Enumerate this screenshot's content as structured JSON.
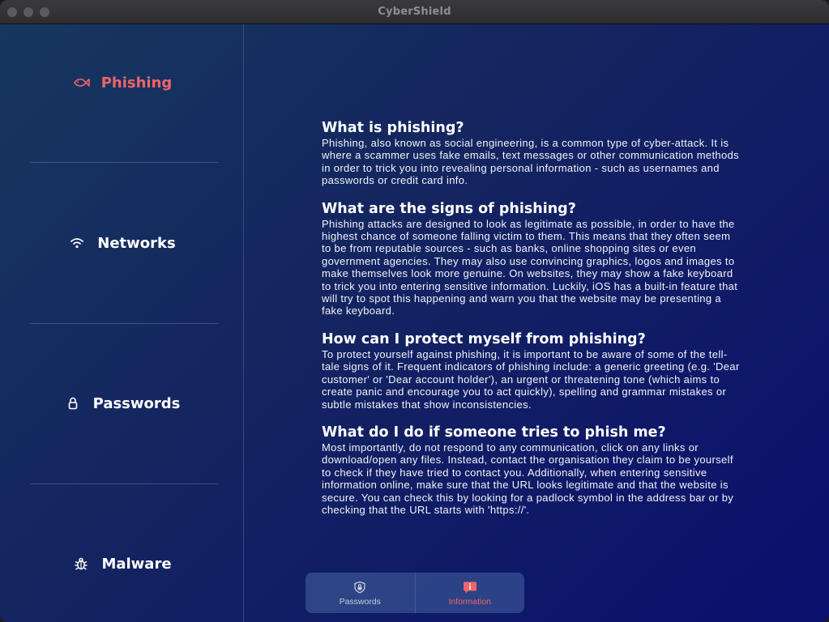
{
  "window": {
    "title": "CyberShield"
  },
  "sidebar": {
    "items": [
      {
        "label": "Phishing",
        "icon": "fish-icon",
        "active": true
      },
      {
        "label": "Networks",
        "icon": "wifi-icon",
        "active": false
      },
      {
        "label": "Passwords",
        "icon": "lock-icon",
        "active": false
      },
      {
        "label": "Malware",
        "icon": "bug-icon",
        "active": false
      }
    ]
  },
  "content": {
    "sections": [
      {
        "heading": "What is phishing?",
        "body": "Phishing, also known as social engineering, is a common type of cyber-attack. It is where a scammer uses fake emails, text messages or other communication methods in order to trick you into revealing personal information - such as usernames and passwords or credit card info."
      },
      {
        "heading": "What are the signs of phishing?",
        "body": "Phishing attacks are designed to look as legitimate as possible, in order to have the highest chance of someone falling victim to them. This means that they often seem to be from reputable sources - such as banks, online shopping sites or even government agencies. They may also use convincing graphics, logos and images to make themselves look more genuine. On websites, they may show a fake keyboard to trick you into entering sensitive information. Luckily, iOS has a built-in feature that will try to spot this happening and warn you that the website may be presenting a fake keyboard."
      },
      {
        "heading": "How can I protect myself from phishing?",
        "body": "To protect yourself against phishing, it is important to be aware of some of the tell-tale signs of it. Frequent indicators of phishing include: a generic greeting (e.g. 'Dear customer' or 'Dear account holder'), an urgent or threatening tone (which aims to create panic and encourage you to act quickly), spelling and grammar mistakes or subtle mistakes that show inconsistencies."
      },
      {
        "heading": "What do I do if someone tries to phish me?",
        "body": "Most importantly, do not respond to any communication, click on any links or download/open any files. Instead, contact the organisation they claim to be yourself to check if they have tried to contact you. Additionally, when entering sensitive information online, make sure that the URL looks legitimate and that the website is secure. You can check this by looking for a padlock symbol in the address bar or by checking that the URL starts with 'https://'."
      }
    ]
  },
  "tabbar": {
    "tabs": [
      {
        "label": "Passwords",
        "icon": "shield-lock-icon",
        "active": false
      },
      {
        "label": "Information",
        "icon": "info-bubble-icon",
        "active": true
      }
    ]
  },
  "colors": {
    "accent": "#f06565",
    "background_start": "#17385f",
    "background_end": "#0b0f6e"
  }
}
